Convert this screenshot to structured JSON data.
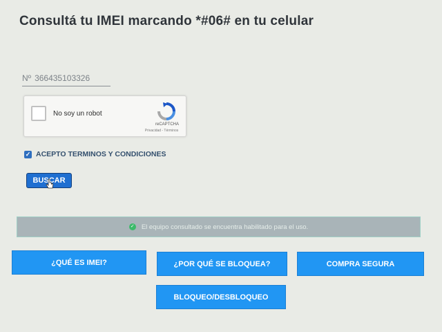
{
  "header": {
    "title": "Consultá tu IMEI marcando *#06# en tu celular"
  },
  "imei": {
    "prefix": "Nº",
    "value": "366435103326"
  },
  "recaptcha": {
    "label": "No soy un robot",
    "brand": "reCAPTCHA",
    "links": "Privacidad - Términos",
    "checked": false
  },
  "terms": {
    "label": "ACEPTO TERMINOS Y CONDICIONES",
    "checked": true
  },
  "search": {
    "button_label": "BUSCAR"
  },
  "status": {
    "message": "El equipo consultado se encuentra habilitado para el uso.",
    "icon": "check-circle-icon",
    "color": "#3dba6a"
  },
  "nav_buttons": [
    {
      "label": "¿QUÉ ES IMEI?"
    },
    {
      "label": "¿POR QUÉ SE BLOQUEA?"
    },
    {
      "label": "COMPRA SEGURA"
    },
    {
      "label": "BLOQUEO/DESBLOQUEO"
    }
  ],
  "colors": {
    "accent": "#2196f3",
    "primary_button": "#1f6fd1",
    "status_bg": "#a9b4b8"
  }
}
